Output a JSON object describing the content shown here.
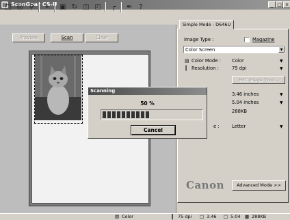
{
  "window": {
    "title": "ScanGear CS-U",
    "controls": [
      "_",
      "□",
      "×"
    ]
  },
  "toolbar": {
    "icons": [
      "marquee-icon",
      "select-icon",
      "zoom-icon",
      "fit-icon",
      "autocrop-icon",
      "rotate-icon",
      "mirror-icon",
      "flip-icon",
      "frame-icon",
      "eyedropper-icon",
      "help-icon"
    ]
  },
  "preview_panel": {
    "preview_label": "Preview",
    "scan_label": "Scan",
    "clear_label": "Clear"
  },
  "settings_panel": {
    "tab_label": "Simple Mode - D646U",
    "image_type_label": "Image Type :",
    "image_type_value": "Color Screen",
    "magazine_label": "Magazine",
    "magazine_checked": false,
    "color_mode_label": "Color Mode :",
    "color_mode_value": "Color",
    "resolution_label": "Resolution :",
    "resolution_value": "75 dpi",
    "edit_image_type_label": "Edit Image Type...",
    "width_value": "3.46 inches",
    "height_value": "5.04 inches",
    "file_size_value": "288KB",
    "paper_label_fragment": "e :",
    "paper_value": "Letter",
    "brand": "Canon",
    "advanced_mode_label": "Advanced Mode >>"
  },
  "scanning_dialog": {
    "title": "Scanning",
    "percent": "50 %",
    "progress": 0.5,
    "cancel_label": "Cancel"
  },
  "status_bar": {
    "color_mode": "Color",
    "resolution": "75 dpi",
    "width": "3.46",
    "height": "5.04",
    "size": "288KB"
  }
}
